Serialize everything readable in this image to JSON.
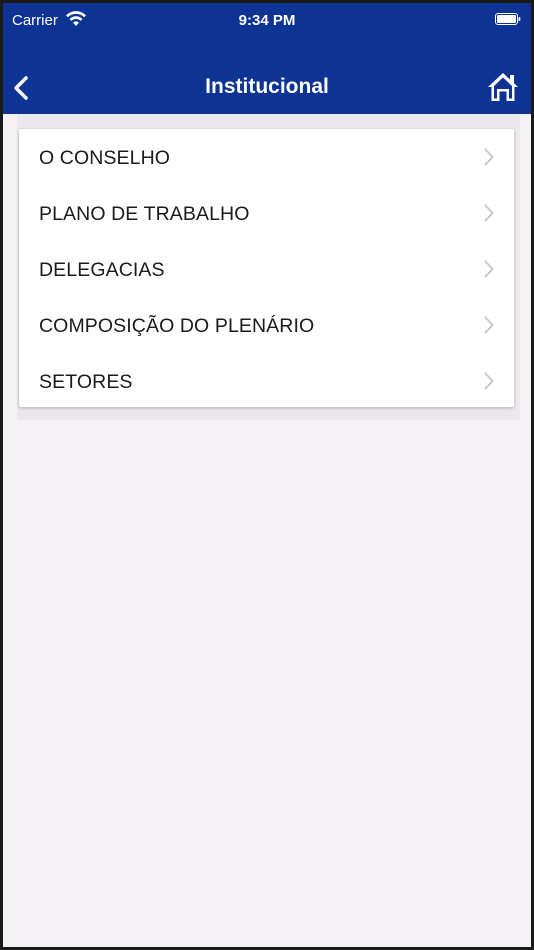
{
  "status_bar": {
    "carrier": "Carrier",
    "time": "9:34 PM",
    "icons": [
      "wifi-icon",
      "battery-icon"
    ]
  },
  "navbar": {
    "title": "Institucional",
    "back_icon": "chevron-left-icon",
    "home_icon": "home-icon"
  },
  "menu": {
    "items": [
      {
        "label": "O CONSELHO"
      },
      {
        "label": "PLANO DE TRABALHO"
      },
      {
        "label": "DELEGACIAS"
      },
      {
        "label": "COMPOSIÇÃO DO PLENÁRIO"
      },
      {
        "label": "SETORES"
      }
    ],
    "chevron_icon": "chevron-right-icon"
  },
  "colors": {
    "header": "#0d3494",
    "background": "#f5f2f6",
    "chevron": "#c7c7cc"
  }
}
